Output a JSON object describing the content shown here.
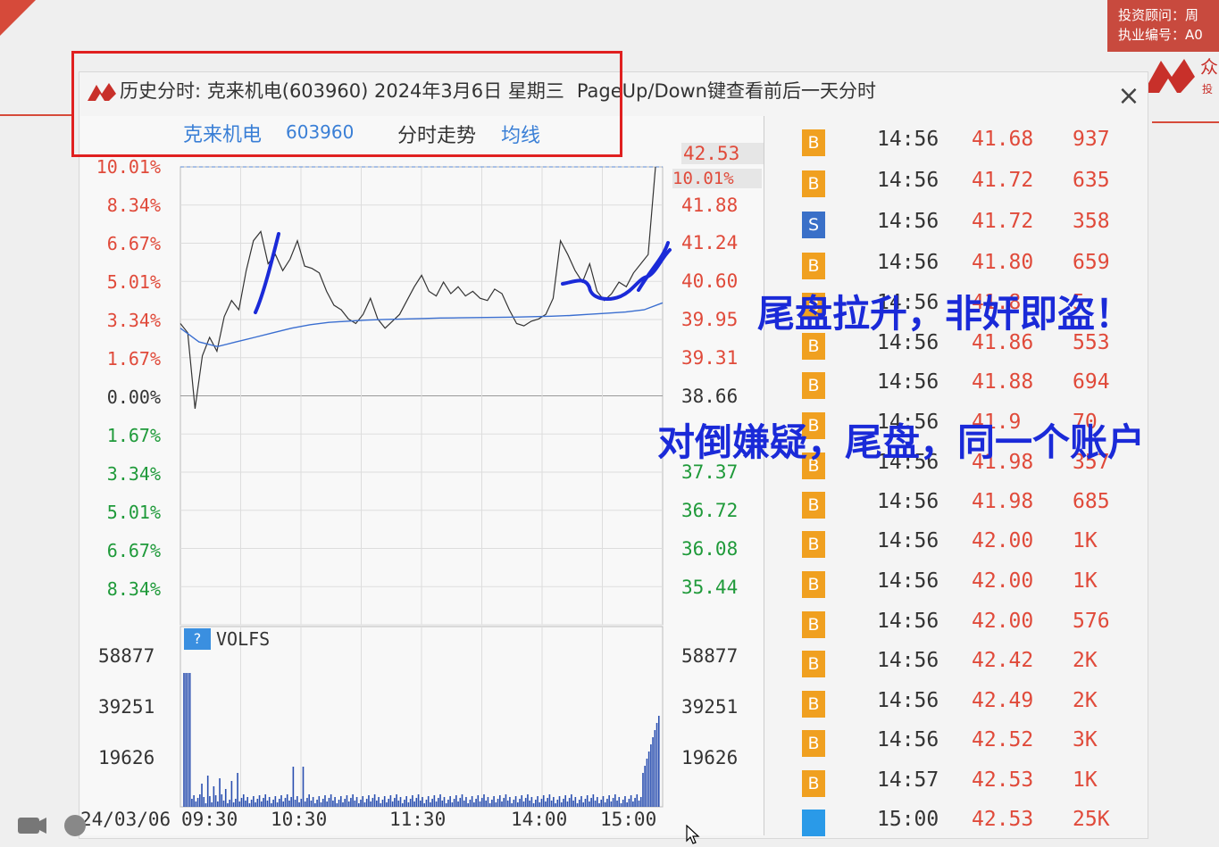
{
  "advisor": {
    "line1": "投资顾问：周",
    "line2": "执业编号：A0"
  },
  "dialog": {
    "title": "历史分时: 克来机电(603960) 2024年3月6日 星期三",
    "hint": "PageUp/Down键查看前后一天分时",
    "close_label": "×"
  },
  "header": {
    "stock_name": "克来机电",
    "stock_code": "603960",
    "trend_label": "分时走势",
    "avg_label": "均线"
  },
  "chart_data": {
    "type": "line",
    "title": "",
    "x_ticks": [
      "09:30",
      "10:30",
      "11:30",
      "14:00",
      "15:00"
    ],
    "date": "24/03/06",
    "left_pct_up": [
      "10.01%",
      "8.34%",
      "6.67%",
      "5.01%",
      "3.34%",
      "1.67%",
      "0.00%"
    ],
    "left_pct_down": [
      "1.67%",
      "3.34%",
      "5.01%",
      "6.67%",
      "8.34%"
    ],
    "right_prices_up": [
      "42.53",
      "41.88",
      "41.24",
      "40.60",
      "39.95",
      "39.31",
      "38.66"
    ],
    "right_highlight_pct": "10.01%",
    "right_prices_down": [
      "37.37",
      "36.72",
      "36.08",
      "35.44"
    ],
    "ylim_pct": [
      -10.01,
      10.01
    ],
    "price_series_pct": [
      3.2,
      2.8,
      -0.5,
      1.8,
      2.6,
      2.0,
      3.5,
      4.2,
      3.8,
      5.5,
      6.8,
      7.2,
      5.8,
      6.2,
      5.5,
      6.0,
      6.8,
      5.7,
      5.6,
      5.4,
      4.6,
      4.0,
      3.8,
      3.4,
      3.2,
      3.6,
      4.3,
      3.4,
      3.0,
      3.3,
      3.6,
      4.2,
      4.8,
      5.3,
      4.6,
      4.4,
      5.0,
      4.5,
      4.8,
      4.4,
      4.6,
      4.3,
      4.2,
      4.7,
      4.5,
      3.8,
      3.2,
      3.1,
      3.3,
      3.4,
      3.6,
      4.3,
      6.8,
      6.2,
      5.5,
      5.0,
      5.8,
      4.6,
      4.2,
      4.5,
      5.0,
      4.8,
      5.4,
      5.8,
      6.2,
      10.01
    ],
    "avg_series_pct": [
      3.0,
      2.4,
      2.2,
      2.4,
      2.6,
      2.8,
      3.0,
      3.15,
      3.25,
      3.3,
      3.35,
      3.38,
      3.4,
      3.42,
      3.44,
      3.45,
      3.46,
      3.47,
      3.48,
      3.5,
      3.52,
      3.55,
      3.6,
      3.65,
      3.7,
      3.8,
      4.1
    ],
    "volume_ticks": [
      "58877",
      "39251",
      "19626"
    ],
    "volume_label": "VOLFS",
    "volume_help": "?"
  },
  "trades": [
    {
      "type": "B",
      "time": "14:56",
      "price": "41.68",
      "vol": "937"
    },
    {
      "type": "B",
      "time": "14:56",
      "price": "41.72",
      "vol": "635"
    },
    {
      "type": "S",
      "time": "14:56",
      "price": "41.72",
      "vol": "358"
    },
    {
      "type": "B",
      "time": "14:56",
      "price": "41.80",
      "vol": "659"
    },
    {
      "type": "B",
      "time": "14:56",
      "price": "41.8",
      "vol": "5"
    },
    {
      "type": "B",
      "time": "14:56",
      "price": "41.86",
      "vol": "553"
    },
    {
      "type": "B",
      "time": "14:56",
      "price": "41.88",
      "vol": "694"
    },
    {
      "type": "B",
      "time": "14:56",
      "price": "41.9",
      "vol": "70"
    },
    {
      "type": "B",
      "time": "14:56",
      "price": "41.98",
      "vol": "357"
    },
    {
      "type": "B",
      "time": "14:56",
      "price": "41.98",
      "vol": "685"
    },
    {
      "type": "B",
      "time": "14:56",
      "price": "42.00",
      "vol": "1K"
    },
    {
      "type": "B",
      "time": "14:56",
      "price": "42.00",
      "vol": "1K"
    },
    {
      "type": "B",
      "time": "14:56",
      "price": "42.00",
      "vol": "576"
    },
    {
      "type": "B",
      "time": "14:56",
      "price": "42.42",
      "vol": "2K"
    },
    {
      "type": "B",
      "time": "14:56",
      "price": "42.49",
      "vol": "2K"
    },
    {
      "type": "B",
      "time": "14:56",
      "price": "42.52",
      "vol": "3K"
    },
    {
      "type": "B",
      "time": "14:57",
      "price": "42.53",
      "vol": "1K"
    },
    {
      "type": "",
      "time": "15:00",
      "price": "42.53",
      "vol": "25K"
    }
  ],
  "annotations": {
    "line1": "尾盘拉升，非奸即盗！",
    "line2": "对倒嫌疑，尾盘，同一个账户"
  },
  "colors": {
    "buy_badge": "#f0a020",
    "sell_badge": "#3a70c8",
    "end_badge": "#2a9ae8",
    "up_red": "#e04a3a",
    "down_green": "#1f9a3a",
    "annotation_blue": "#1a2ad8"
  }
}
